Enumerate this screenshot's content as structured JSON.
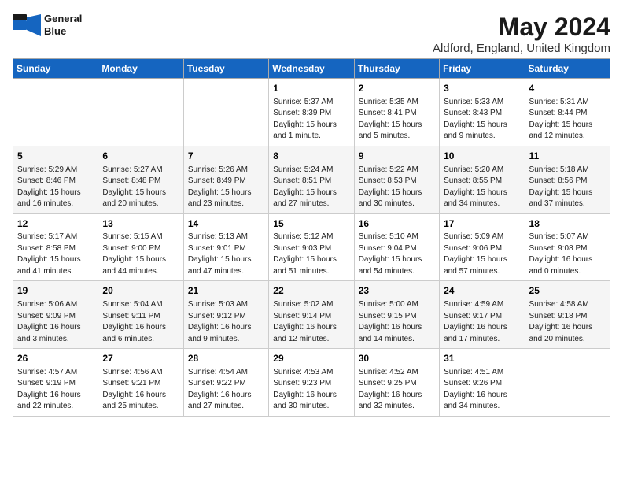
{
  "header": {
    "logo_line1": "General",
    "logo_line2": "Blue",
    "title": "May 2024",
    "subtitle": "Aldford, England, United Kingdom"
  },
  "weekdays": [
    "Sunday",
    "Monday",
    "Tuesday",
    "Wednesday",
    "Thursday",
    "Friday",
    "Saturday"
  ],
  "weeks": [
    [
      {
        "day": "",
        "info": ""
      },
      {
        "day": "",
        "info": ""
      },
      {
        "day": "",
        "info": ""
      },
      {
        "day": "1",
        "info": "Sunrise: 5:37 AM\nSunset: 8:39 PM\nDaylight: 15 hours\nand 1 minute."
      },
      {
        "day": "2",
        "info": "Sunrise: 5:35 AM\nSunset: 8:41 PM\nDaylight: 15 hours\nand 5 minutes."
      },
      {
        "day": "3",
        "info": "Sunrise: 5:33 AM\nSunset: 8:43 PM\nDaylight: 15 hours\nand 9 minutes."
      },
      {
        "day": "4",
        "info": "Sunrise: 5:31 AM\nSunset: 8:44 PM\nDaylight: 15 hours\nand 12 minutes."
      }
    ],
    [
      {
        "day": "5",
        "info": "Sunrise: 5:29 AM\nSunset: 8:46 PM\nDaylight: 15 hours\nand 16 minutes."
      },
      {
        "day": "6",
        "info": "Sunrise: 5:27 AM\nSunset: 8:48 PM\nDaylight: 15 hours\nand 20 minutes."
      },
      {
        "day": "7",
        "info": "Sunrise: 5:26 AM\nSunset: 8:49 PM\nDaylight: 15 hours\nand 23 minutes."
      },
      {
        "day": "8",
        "info": "Sunrise: 5:24 AM\nSunset: 8:51 PM\nDaylight: 15 hours\nand 27 minutes."
      },
      {
        "day": "9",
        "info": "Sunrise: 5:22 AM\nSunset: 8:53 PM\nDaylight: 15 hours\nand 30 minutes."
      },
      {
        "day": "10",
        "info": "Sunrise: 5:20 AM\nSunset: 8:55 PM\nDaylight: 15 hours\nand 34 minutes."
      },
      {
        "day": "11",
        "info": "Sunrise: 5:18 AM\nSunset: 8:56 PM\nDaylight: 15 hours\nand 37 minutes."
      }
    ],
    [
      {
        "day": "12",
        "info": "Sunrise: 5:17 AM\nSunset: 8:58 PM\nDaylight: 15 hours\nand 41 minutes."
      },
      {
        "day": "13",
        "info": "Sunrise: 5:15 AM\nSunset: 9:00 PM\nDaylight: 15 hours\nand 44 minutes."
      },
      {
        "day": "14",
        "info": "Sunrise: 5:13 AM\nSunset: 9:01 PM\nDaylight: 15 hours\nand 47 minutes."
      },
      {
        "day": "15",
        "info": "Sunrise: 5:12 AM\nSunset: 9:03 PM\nDaylight: 15 hours\nand 51 minutes."
      },
      {
        "day": "16",
        "info": "Sunrise: 5:10 AM\nSunset: 9:04 PM\nDaylight: 15 hours\nand 54 minutes."
      },
      {
        "day": "17",
        "info": "Sunrise: 5:09 AM\nSunset: 9:06 PM\nDaylight: 15 hours\nand 57 minutes."
      },
      {
        "day": "18",
        "info": "Sunrise: 5:07 AM\nSunset: 9:08 PM\nDaylight: 16 hours\nand 0 minutes."
      }
    ],
    [
      {
        "day": "19",
        "info": "Sunrise: 5:06 AM\nSunset: 9:09 PM\nDaylight: 16 hours\nand 3 minutes."
      },
      {
        "day": "20",
        "info": "Sunrise: 5:04 AM\nSunset: 9:11 PM\nDaylight: 16 hours\nand 6 minutes."
      },
      {
        "day": "21",
        "info": "Sunrise: 5:03 AM\nSunset: 9:12 PM\nDaylight: 16 hours\nand 9 minutes."
      },
      {
        "day": "22",
        "info": "Sunrise: 5:02 AM\nSunset: 9:14 PM\nDaylight: 16 hours\nand 12 minutes."
      },
      {
        "day": "23",
        "info": "Sunrise: 5:00 AM\nSunset: 9:15 PM\nDaylight: 16 hours\nand 14 minutes."
      },
      {
        "day": "24",
        "info": "Sunrise: 4:59 AM\nSunset: 9:17 PM\nDaylight: 16 hours\nand 17 minutes."
      },
      {
        "day": "25",
        "info": "Sunrise: 4:58 AM\nSunset: 9:18 PM\nDaylight: 16 hours\nand 20 minutes."
      }
    ],
    [
      {
        "day": "26",
        "info": "Sunrise: 4:57 AM\nSunset: 9:19 PM\nDaylight: 16 hours\nand 22 minutes."
      },
      {
        "day": "27",
        "info": "Sunrise: 4:56 AM\nSunset: 9:21 PM\nDaylight: 16 hours\nand 25 minutes."
      },
      {
        "day": "28",
        "info": "Sunrise: 4:54 AM\nSunset: 9:22 PM\nDaylight: 16 hours\nand 27 minutes."
      },
      {
        "day": "29",
        "info": "Sunrise: 4:53 AM\nSunset: 9:23 PM\nDaylight: 16 hours\nand 30 minutes."
      },
      {
        "day": "30",
        "info": "Sunrise: 4:52 AM\nSunset: 9:25 PM\nDaylight: 16 hours\nand 32 minutes."
      },
      {
        "day": "31",
        "info": "Sunrise: 4:51 AM\nSunset: 9:26 PM\nDaylight: 16 hours\nand 34 minutes."
      },
      {
        "day": "",
        "info": ""
      }
    ]
  ]
}
